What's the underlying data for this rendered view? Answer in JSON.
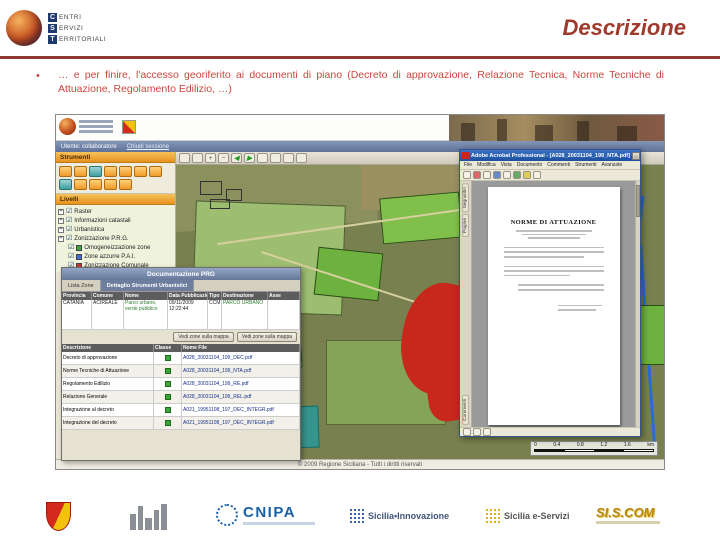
{
  "theme": {
    "accent": "#9e392b",
    "bullet_color": "#c9473c",
    "acrobat_titlebar": "#1c4f9e",
    "map_urban_red": "#c8271b",
    "map_green": "#6db23e",
    "map_teal": "#3aa79e"
  },
  "icons": {
    "bullet": "•",
    "checkbox_checked": "☑",
    "expand": "+",
    "arrow_left": "◀",
    "arrow_right": "▶",
    "zoom_in": "+",
    "zoom_out": "−",
    "minimize": "_",
    "maximize": "□",
    "close": "✕"
  },
  "slide": {
    "title": "Descrizione",
    "bullet": "…  e per finire,  l'accesso georiferito ai documenti di piano (Decreto di approvazione, Relazione Tecnica, Norme Tecniche di Attuazione, Regolamento Edilizio, …)"
  },
  "brand": {
    "l1i": "C",
    "l1r": "ENTRI",
    "l2i": "S",
    "l2r": "ERVIZI",
    "l3i": "T",
    "l3r": "ERRITORIALI"
  },
  "gis": {
    "session_user": "Utente: collaboratore",
    "session_logout": "Chiudi sessione",
    "tools_title": "Strumenti",
    "levels_title": "Livelli",
    "layers": [
      "Raster",
      "Informazioni catastali",
      "Urbanistica",
      "Zonizzazione P.R.G.",
      "Omogeneizzazione zone",
      "Zone azzurre P.A.I.",
      "Zonizzazione Comunale"
    ],
    "copyright": "© 2009 Regione Siciliana - Tutti i diritti riservati",
    "scalebar": [
      "0",
      "0.4",
      "0.8",
      "1.2",
      "1.6"
    ],
    "scalebar_unit": "km"
  },
  "popup": {
    "title": "Documentazione PRG",
    "tabs": [
      "Lista Zone",
      "Dettaglio Strumenti Urbanistici"
    ],
    "zones_headers": [
      "Provincia",
      "Comune",
      "Nome",
      "Data Pubblicazione",
      "Tipo",
      "Destinazione",
      "Asse"
    ],
    "zone_row": [
      "CATANIA",
      "ACIREALE",
      "Parco urbano, verde pubblico",
      "09/11/2009 12:22:44",
      "CCM",
      "PARCO URBANO",
      ""
    ],
    "zoom_button": "Vedi zone sulla mappa",
    "docs_headers": [
      "Descrizione",
      "Classe",
      "Nome File"
    ],
    "docs_rows": [
      {
        "desc": "Decreto di approvazione",
        "file": "A028_20031104_199_DEC.pdf"
      },
      {
        "desc": "Norme Tecniche di Attuazione",
        "file": "A028_20031104_199_NTA.pdf"
      },
      {
        "desc": "Regolamento Edilizio",
        "file": "A028_20031104_199_RE.pdf"
      },
      {
        "desc": "Relazione Generale",
        "file": "A028_20031104_199_REL.pdf"
      },
      {
        "desc": "Integrazione al decreto",
        "file": "A021_19951108_197_DEC_INTEGR.pdf"
      },
      {
        "desc": "Integrazione del decreto",
        "file": "A021_19951108_197_DEC_INTEGR.pdf"
      }
    ]
  },
  "acrobat": {
    "title": "Adobe Acrobat Professional - [A028_20031104_199_NTA.pdf]",
    "menu": [
      "File",
      "Modifica",
      "Vista",
      "Documento",
      "Commenti",
      "Strumenti",
      "Avanzate"
    ],
    "side_tabs": [
      "Segnalibri",
      "Pagine"
    ],
    "side_tab_bottom": "Commenti",
    "doc_heading": "NORME DI ATTUAZIONE"
  },
  "footer": {
    "cnipa": "CNIPA",
    "sicilia_innovazione": "Sicilia•Innovazione",
    "sicilia_eservizi": "Sicilia e-Servizi",
    "siscom": "SI.S.COM"
  }
}
